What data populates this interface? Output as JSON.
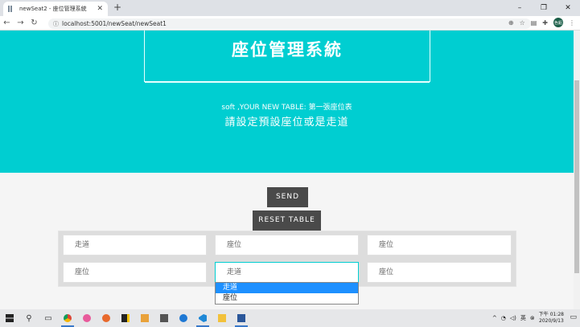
{
  "browser": {
    "tab_title": "newSeat2 - 座位管理系統",
    "url": "localhost:5001/newSeat/newSeat1",
    "avatar_text": "色鉛"
  },
  "hero": {
    "title": "座位管理系統",
    "subtitle": "soft ,YOUR NEW TABLE:   第一張座位表",
    "instruction": "請設定預設座位或是走道"
  },
  "buttons": {
    "send": "SEND",
    "reset": "RESET TABLE"
  },
  "seats": {
    "row1": [
      "走道",
      "座位",
      "座位"
    ],
    "row2": [
      "座位",
      "走道",
      "座位"
    ]
  },
  "dropdown": {
    "options": [
      "走道",
      "座位"
    ],
    "selected_index": 0
  },
  "taskbar": {
    "time": "下午 01:28",
    "date": "2020/9/13"
  },
  "colors": {
    "hero_bg": "#00ced1",
    "button_bg": "#4a4a4a",
    "selection": "#1e90ff"
  }
}
